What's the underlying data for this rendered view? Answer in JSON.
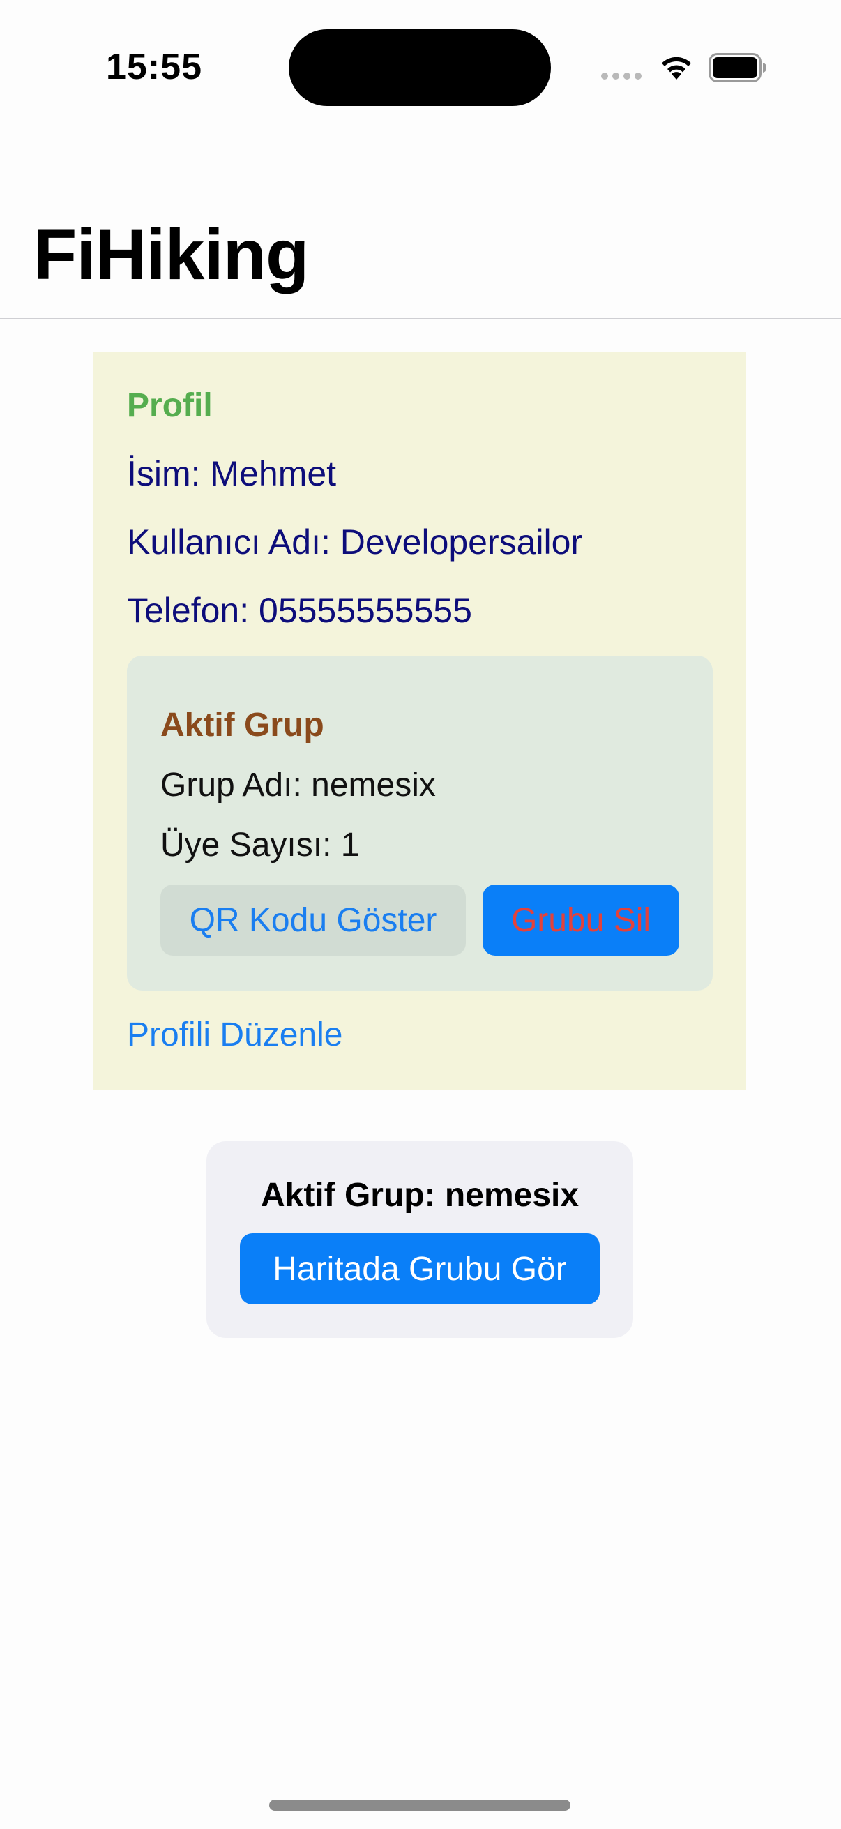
{
  "status_bar": {
    "time": "15:55",
    "signal_icon": "cellular-signal-icon",
    "wifi_icon": "wifi-icon",
    "battery_icon": "battery-icon"
  },
  "nav": {
    "title": "FiHiking"
  },
  "profile": {
    "heading": "Profil",
    "name_line": "İsim: Mehmet",
    "username_line": "Kullanıcı Adı: Developersailor",
    "phone_line": "Telefon: 05555555555",
    "edit_label": "Profili Düzenle"
  },
  "active_group": {
    "heading": "Aktif Grup",
    "name_line": "Grup Adı: nemesix",
    "member_count_line": "Üye Sayısı: 1",
    "qr_button_label": "QR Kodu Göster",
    "delete_button_label": "Grubu Sil"
  },
  "summary": {
    "title": "Aktif Grup: nemesix",
    "map_button_label": "Haritada Grubu Gör"
  },
  "colors": {
    "profile_background": "#f4f4db",
    "profile_heading": "#55ad4f",
    "profile_text": "#0d0d7a",
    "group_background": "#e0eadf",
    "group_heading": "#8a4a1c",
    "accent_blue": "#0a7ff8",
    "link_blue": "#1a7ef0",
    "delete_text": "#e2423c",
    "summary_background": "#f0f0f5"
  }
}
